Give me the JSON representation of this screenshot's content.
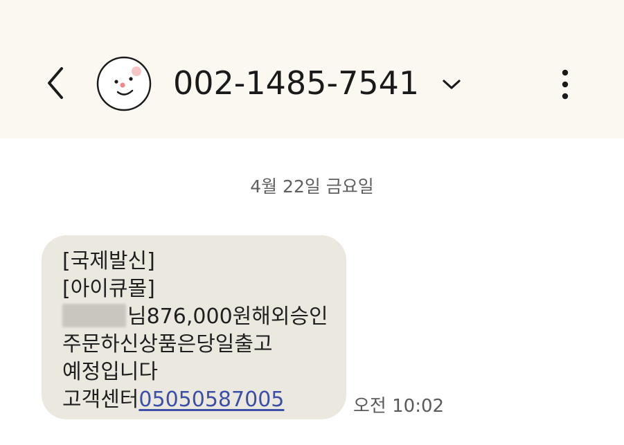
{
  "header": {
    "contact_number": "002-1485-7541",
    "back_icon": "chevron-left-icon",
    "dropdown_icon": "chevron-down-icon",
    "more_icon": "more-vertical-icon",
    "avatar_icon": "smiley-face-avatar",
    "background_color": "#fbf8f1"
  },
  "conversation": {
    "date_separator": "4월 22일 금요일",
    "messages": [
      {
        "line1": "[국제발신]",
        "line2": "[아이큐몰]",
        "line3_text": "님876,000원해외승인",
        "line4": "주문하신상품은당일출고",
        "line5": "예정입니다",
        "line6_prefix": "고객센터",
        "phone_link": "05050587005",
        "time": "오전 10:02",
        "bubble_color": "#ebe8df",
        "link_color": "#3b4fa8"
      }
    ]
  }
}
